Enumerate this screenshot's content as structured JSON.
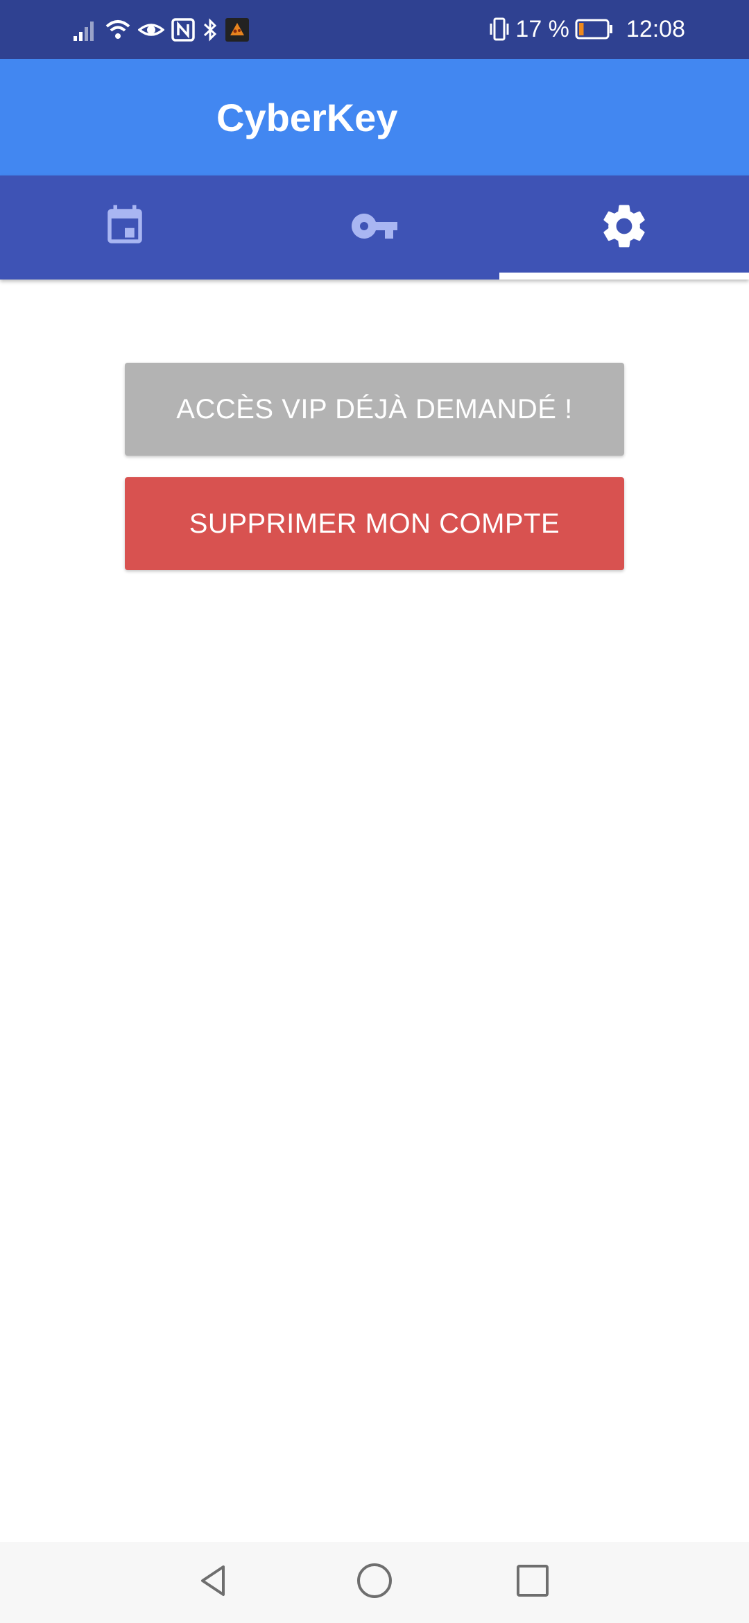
{
  "status_bar": {
    "battery_percent": "17 %",
    "time": "12:08",
    "battery_level": 0.17,
    "icons": [
      "signal-icon",
      "wifi-icon",
      "eye-icon",
      "nfc-icon",
      "bluetooth-icon",
      "app-notification-icon",
      "vibrate-icon",
      "battery-icon"
    ]
  },
  "app_bar": {
    "title": "CyberKey"
  },
  "tabs": [
    {
      "icon": "calendar-icon",
      "selected": false
    },
    {
      "icon": "key-icon",
      "selected": false
    },
    {
      "icon": "settings-icon",
      "selected": true
    }
  ],
  "actions": {
    "vip_label": "ACCÈS VIP DÉJÀ DEMANDÉ !",
    "delete_label": "SUPPRIMER MON COMPTE"
  },
  "colors": {
    "status_bar": "#2f4191",
    "app_bar": "#4287f1",
    "tab_bar": "#3e53b5",
    "vip_button": "#b3b3b3",
    "delete_button": "#d85250"
  },
  "nav_bar": {
    "buttons": [
      "back-icon",
      "home-icon",
      "recents-icon"
    ]
  }
}
